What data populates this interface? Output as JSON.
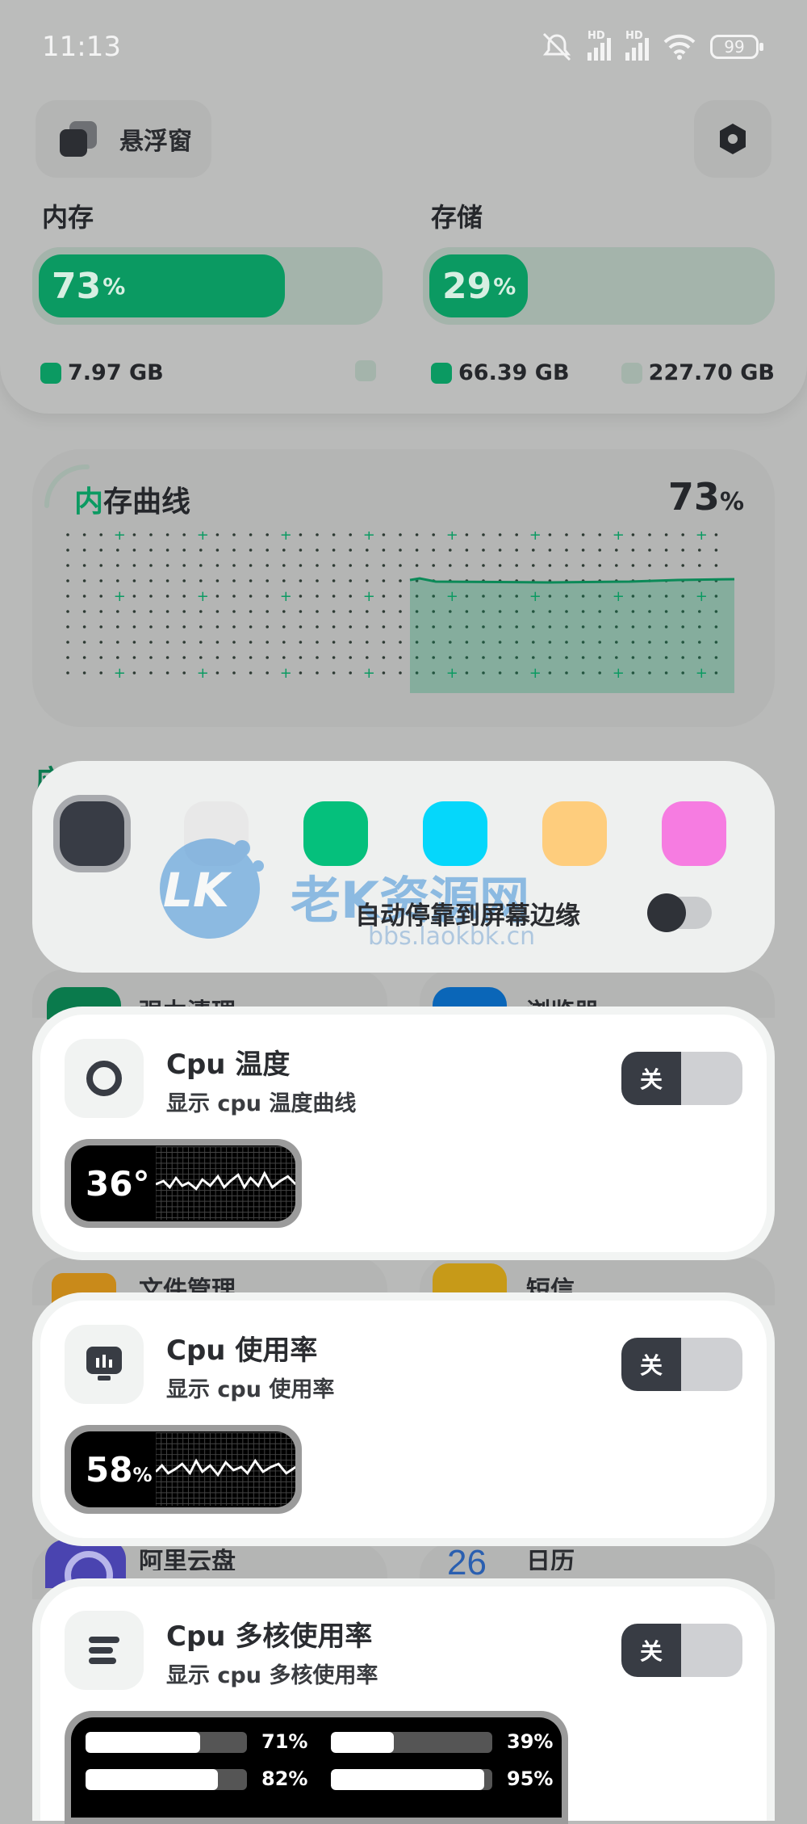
{
  "status_bar": {
    "time": "11:13",
    "battery": "99",
    "network_badge_1": "HD",
    "network_badge_2": "HD"
  },
  "header": {
    "floating_window_label": "悬浮窗"
  },
  "memory": {
    "title": "内存",
    "percent": "73",
    "percent_sign": "%",
    "fill_fraction": 0.73,
    "used_label": "7.97 GB",
    "free_label": ""
  },
  "storage": {
    "title": "存储",
    "percent": "29",
    "percent_sign": "%",
    "fill_fraction": 0.29,
    "used_label": "66.39 GB",
    "total_label": "227.70 GB"
  },
  "memory_curve": {
    "title": "内存曲线",
    "title_accent": "内",
    "title_rest": "存曲线",
    "percent": "73",
    "percent_sign": "%"
  },
  "behind": {
    "section_title": "应",
    "item_1": "强力清理",
    "item_2": "浏览器",
    "item_3": "文件管理",
    "item_4": "短信",
    "item_5": "阿里云盘",
    "item_6": "日历",
    "calendar_day": "26"
  },
  "color_picker": {
    "swatches": [
      "#383c45",
      "#e8e8e8",
      "#05c07c",
      "#05d7fb",
      "#fecd7d",
      "#f67ce1"
    ],
    "selected_index": 0,
    "auto_dock_label": "自动停靠到屏幕边缘",
    "auto_dock_on": false
  },
  "watermark": {
    "logo": "LK",
    "text": "老K资源网",
    "url": "bbs.laokbk.cn"
  },
  "cpu_temp": {
    "title": "Cpu 温度",
    "subtitle": "显示 cpu 温度曲线",
    "toggle_label": "关",
    "value": "36°"
  },
  "cpu_usage": {
    "title": "Cpu 使用率",
    "subtitle": "显示 cpu 使用率",
    "toggle_label": "关",
    "value": "58",
    "value_unit": "%"
  },
  "cpu_multicore": {
    "title": "Cpu 多核使用率",
    "subtitle": "显示 cpu 多核使用率",
    "toggle_label": "关",
    "cores": [
      {
        "label": "71%",
        "fraction": 0.71
      },
      {
        "label": "39%",
        "fraction": 0.39
      },
      {
        "label": "82%",
        "fraction": 0.82
      },
      {
        "label": "95%",
        "fraction": 0.95
      }
    ]
  },
  "colors": {
    "accent_green": "#0b9a62",
    "dark": "#383c44",
    "white_card": "#ffffff"
  }
}
